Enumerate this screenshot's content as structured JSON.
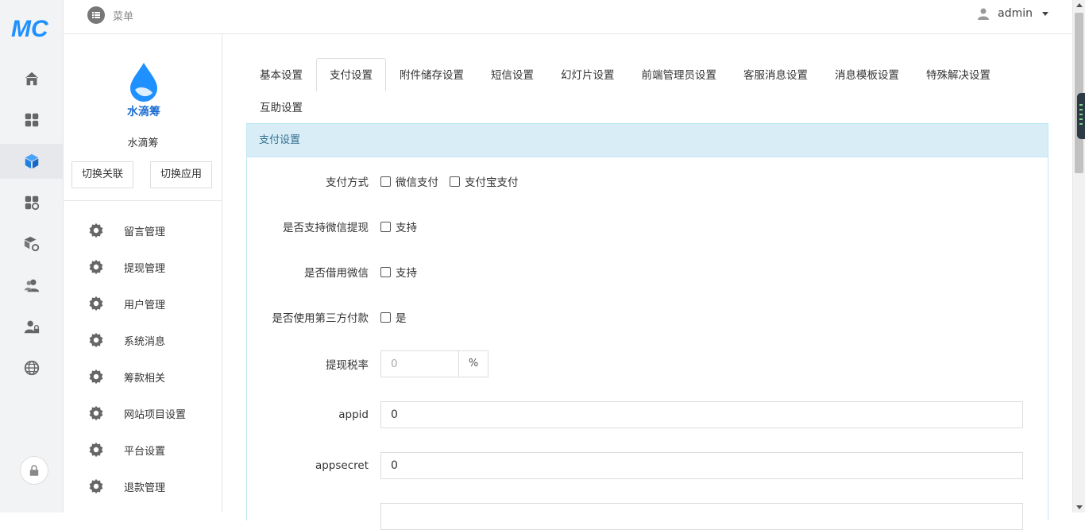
{
  "brand": {
    "logo_text": "MC",
    "color": "#1e90ff"
  },
  "topbar": {
    "menu_label": "菜单",
    "user_name": "admin"
  },
  "rail": {
    "items": [
      "home-icon",
      "apps-icon",
      "cube-icon",
      "apps-gear-icon",
      "box-gear-icon",
      "users-icon",
      "user-lock-icon",
      "globe-icon"
    ],
    "active_index": 2
  },
  "app": {
    "logo_text": "水滴筹",
    "name": "水滴筹",
    "switch_link_label": "切换关联",
    "switch_app_label": "切换应用"
  },
  "side_menu": [
    {
      "label": "留言管理"
    },
    {
      "label": "提现管理"
    },
    {
      "label": "用户管理"
    },
    {
      "label": "系统消息"
    },
    {
      "label": "筹款相关"
    },
    {
      "label": "网站项目设置"
    },
    {
      "label": "平台设置"
    },
    {
      "label": "退款管理"
    }
  ],
  "tabs": [
    {
      "label": "基本设置"
    },
    {
      "label": "支付设置"
    },
    {
      "label": "附件储存设置"
    },
    {
      "label": "短信设置"
    },
    {
      "label": "幻灯片设置"
    },
    {
      "label": "前端管理员设置"
    },
    {
      "label": "客服消息设置"
    },
    {
      "label": "消息模板设置"
    },
    {
      "label": "特殊解决设置"
    },
    {
      "label": "互助设置"
    }
  ],
  "active_tab": "支付设置",
  "panel": {
    "title": "支付设置",
    "pay_method": {
      "label": "支付方式",
      "options": [
        "微信支付",
        "支付宝支付"
      ]
    },
    "wechat_withdraw": {
      "label": "是否支持微信提现",
      "option": "支持"
    },
    "borrow_wechat": {
      "label": "是否借用微信",
      "option": "支持"
    },
    "third_party": {
      "label": "是否使用第三方付款",
      "option": "是"
    },
    "tax_rate": {
      "label": "提现税率",
      "placeholder": "0",
      "unit": "%"
    },
    "appid": {
      "label": "appid",
      "value": "0"
    },
    "appsecret": {
      "label": "appsecret",
      "value": "0"
    }
  }
}
